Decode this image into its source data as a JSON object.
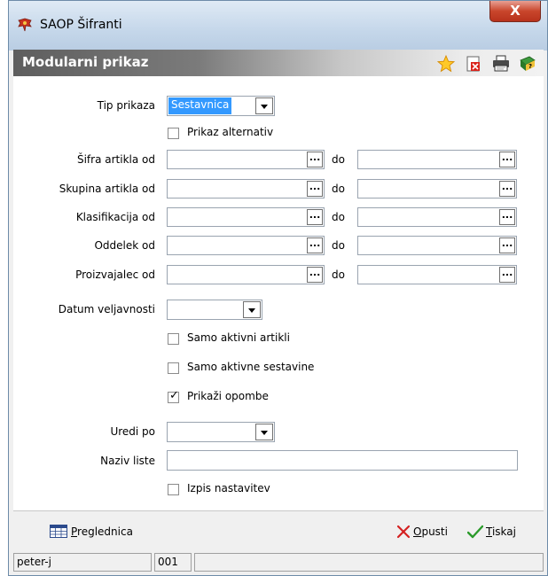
{
  "window": {
    "title": "SAOP Šifranti",
    "close_label": "X"
  },
  "header": {
    "title": "Modularni prikaz",
    "icons": [
      "star-icon",
      "delete-doc-icon",
      "print-icon",
      "help-book-icon"
    ]
  },
  "form": {
    "tip_prikaza": {
      "label": "Tip prikaza",
      "value": "Sestavnica"
    },
    "prikaz_alternativ": {
      "label": "Prikaz alternativ",
      "checked": false
    },
    "ranges": [
      {
        "label": "Šifra artikla od",
        "to_label": "do",
        "from": "",
        "to": ""
      },
      {
        "label": "Skupina artikla od",
        "to_label": "do",
        "from": "",
        "to": ""
      },
      {
        "label": "Klasifikacija od",
        "to_label": "do",
        "from": "",
        "to": ""
      },
      {
        "label": "Oddelek od",
        "to_label": "do",
        "from": "",
        "to": ""
      },
      {
        "label": "Proizvajalec od",
        "to_label": "do",
        "from": "",
        "to": ""
      }
    ],
    "ellipsis": "...",
    "datum_veljavnosti": {
      "label": "Datum veljavnosti",
      "value": ""
    },
    "samo_aktivni_artikli": {
      "label": "Samo aktivni artikli",
      "checked": false
    },
    "samo_aktivne_sestavine": {
      "label": "Samo aktivne sestavine",
      "checked": false
    },
    "prikazi_opombe": {
      "label": "Prikaži opombe",
      "checked": true
    },
    "uredi_po": {
      "label": "Uredi po",
      "value": ""
    },
    "naziv_liste": {
      "label": "Naziv liste",
      "value": ""
    },
    "izpis_nastavitev": {
      "label": "Izpis nastavitev",
      "checked": false
    }
  },
  "footer": {
    "preglednica_first": "P",
    "preglednica_rest": "reglednica",
    "opusti_first": "O",
    "opusti_rest": "pusti",
    "tiskaj_first": "T",
    "tiskaj_rest": "iskaj"
  },
  "status": {
    "user": "peter-j",
    "code": "001",
    "extra": ""
  }
}
